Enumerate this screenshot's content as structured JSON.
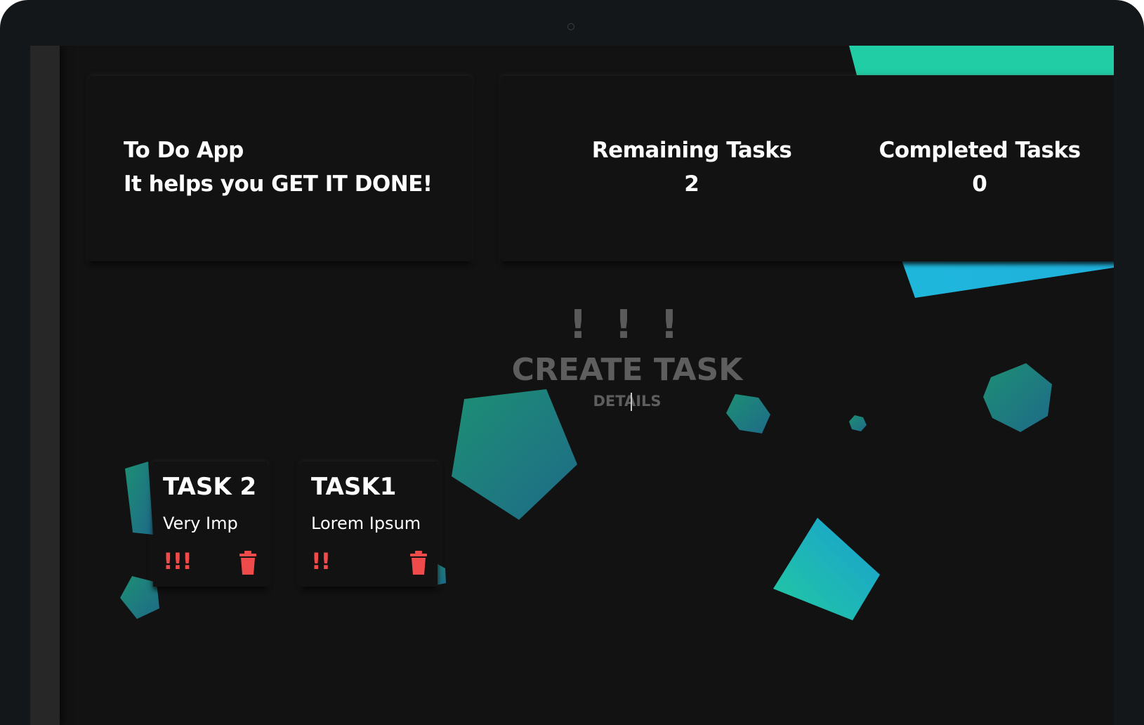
{
  "header": {
    "title": "To Do App",
    "tagline": "It helps you GET IT DONE!"
  },
  "stats": {
    "remaining_label": "Remaining Tasks",
    "remaining_count": "2",
    "completed_label": "Completed Tasks",
    "completed_count": "0"
  },
  "create_task": {
    "priority_marks": "! ! !",
    "title_placeholder": "CREATE TASK",
    "details_placeholder": "DETAILS"
  },
  "tasks": [
    {
      "title": "TASK 2",
      "description": "Very Imp",
      "priority": "!!!",
      "priority_level": 3
    },
    {
      "title": "TASK1",
      "description": "Lorem Ipsum",
      "priority": "!!",
      "priority_level": 2
    }
  ],
  "colors": {
    "background": "#121212",
    "priority": "#ef4b4b",
    "accent_teal": "#1fcfa2",
    "accent_blue": "#1fb6dd",
    "placeholder": "#5e5e5e"
  },
  "icons": {
    "delete": "trash-icon"
  }
}
